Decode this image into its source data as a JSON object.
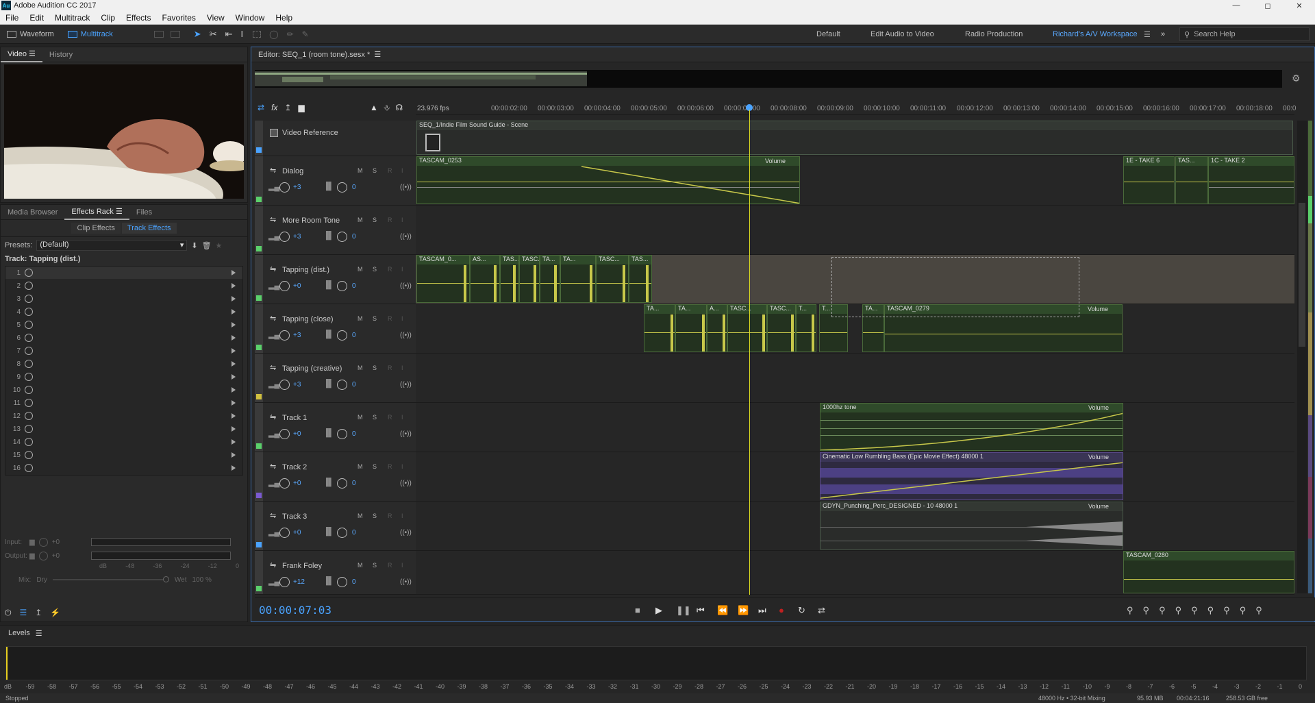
{
  "app": {
    "title": "Adobe Audition CC 2017",
    "logo_text": "Au"
  },
  "menu": [
    "File",
    "Edit",
    "Multitrack",
    "Clip",
    "Effects",
    "Favorites",
    "View",
    "Window",
    "Help"
  ],
  "toolbar": {
    "waveform": "Waveform",
    "multitrack": "Multitrack",
    "accent": "#4aa3ff"
  },
  "workspaces": [
    "Default",
    "Edit Audio to Video",
    "Radio Production",
    "Richard's A/V Workspace"
  ],
  "search": {
    "placeholder": "Search Help"
  },
  "left": {
    "top_tabs": [
      "Video",
      "History"
    ],
    "mid_tabs": [
      "Media Browser",
      "Effects Rack",
      "Files"
    ],
    "sub_tabs": [
      "Clip Effects",
      "Track Effects"
    ],
    "presets_label": "Presets:",
    "preset_value": "(Default)",
    "track_label": "Track: Tapping (dist.)",
    "slots": [
      "1",
      "2",
      "3",
      "4",
      "5",
      "6",
      "7",
      "8",
      "9",
      "10",
      "11",
      "12",
      "13",
      "14",
      "15",
      "16"
    ],
    "input_label": "Input:",
    "output_label": "Output:",
    "io_val": "+0",
    "db_scale": [
      "dB",
      "-48",
      "-36",
      "-24",
      "-12",
      "0"
    ],
    "mix_label": "Mix:",
    "dry": "Dry",
    "wet": "Wet",
    "wet_pct": "100 %"
  },
  "editor": {
    "title": "Editor: SEQ_1 (room tone).sesx *",
    "fps": "23.976 fps"
  },
  "ruler": [
    "00:00:02:00",
    "00:00:03:00",
    "00:00:04:00",
    "00:00:05:00",
    "00:00:06:00",
    "00:00:07:00",
    "00:00:08:00",
    "00:00:09:00",
    "00:00:10:00",
    "00:00:11:00",
    "00:00:12:00",
    "00:00:13:00",
    "00:00:14:00",
    "00:00:15:00",
    "00:00:16:00",
    "00:00:17:00",
    "00:00:18:00",
    "00:0"
  ],
  "tracks": [
    {
      "name": "Video Reference",
      "video": true,
      "color": "#4aa3ff"
    },
    {
      "name": "Dialog",
      "vol": "+3",
      "pan": "0",
      "color": "#5bd06b"
    },
    {
      "name": "More Room Tone",
      "vol": "+3",
      "pan": "0",
      "color": "#5bd06b"
    },
    {
      "name": "Tapping (dist.)",
      "vol": "+0",
      "pan": "0",
      "color": "#5bd06b"
    },
    {
      "name": "Tapping (close)",
      "vol": "+3",
      "pan": "0",
      "color": "#5bd06b"
    },
    {
      "name": "Tapping (creative)",
      "vol": "+3",
      "pan": "0",
      "color": "#d0c040"
    },
    {
      "name": "Track 1",
      "vol": "+0",
      "pan": "0",
      "color": "#5bd06b"
    },
    {
      "name": "Track 2",
      "vol": "+0",
      "pan": "0",
      "color": "#7a5ad0"
    },
    {
      "name": "Track 3",
      "vol": "+0",
      "pan": "0",
      "color": "#4aa3ff"
    },
    {
      "name": "Frank Foley",
      "vol": "+12",
      "pan": "0",
      "color": "#5bd06b"
    }
  ],
  "track_btns": {
    "m": "M",
    "s": "S",
    "r": "R",
    "i": "I"
  },
  "clips": {
    "video": "SEQ_1/Indie Film Sound Guide - Scene",
    "dialog": "TASCAM_0253",
    "dialog_r1": "1E - TAKE 6",
    "dialog_r2": "TAS...",
    "dialog_r3": "1C - TAKE 2",
    "vol": "Volume",
    "dist": [
      "TASCAM_0...",
      "AS...",
      "TAS...",
      "TASC...",
      "TA...",
      "TA...",
      "TASC...",
      "TAS..."
    ],
    "close": [
      "TA...",
      "TA...",
      "A...",
      "TASC...",
      "TASC...",
      "T..."
    ],
    "close_sel": "T...",
    "close_a": "TA...",
    "close_b": "TASCAM_0279",
    "t1": "1000hz tone",
    "t2": "Cinematic Low Rumbling Bass (Epic Movie Effect) 48000 1",
    "t3": "GDYN_Punching_Perc_DESIGNED - 10 48000 1",
    "foley": "TASCAM_0280"
  },
  "timecode": "00:00:07:03",
  "levels": {
    "title": "Levels",
    "scale": [
      "dB",
      "-59",
      "-58",
      "-57",
      "-56",
      "-55",
      "-54",
      "-53",
      "-52",
      "-51",
      "-50",
      "-49",
      "-48",
      "-47",
      "-46",
      "-45",
      "-44",
      "-43",
      "-42",
      "-41",
      "-40",
      "-39",
      "-38",
      "-37",
      "-36",
      "-35",
      "-34",
      "-33",
      "-32",
      "-31",
      "-30",
      "-29",
      "-28",
      "-27",
      "-26",
      "-25",
      "-24",
      "-23",
      "-22",
      "-21",
      "-20",
      "-19",
      "-18",
      "-17",
      "-16",
      "-15",
      "-14",
      "-13",
      "-12",
      "-11",
      "-10",
      "-9",
      "-8",
      "-7",
      "-6",
      "-5",
      "-4",
      "-3",
      "-2",
      "-1",
      "0"
    ]
  },
  "status": {
    "left": "Stopped",
    "r1": "48000 Hz • 32-bit Mixing",
    "r2": "95.93 MB",
    "r3": "00:04:21:16",
    "r4": "258.53 GB free"
  }
}
